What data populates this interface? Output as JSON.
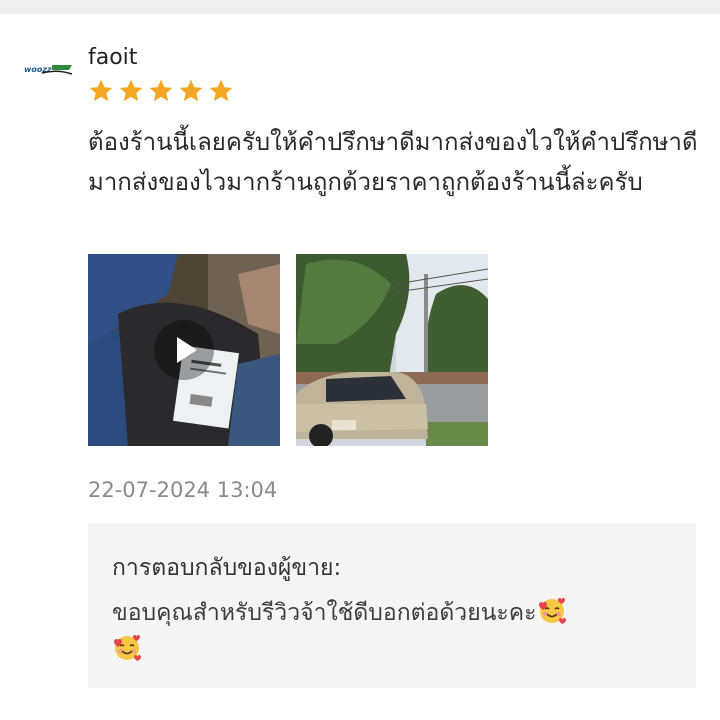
{
  "review": {
    "username": "faoit",
    "rating": 5,
    "text": "ต้องร้านนี้เลยครับให้คำปรึกษาดีมากส่งของไวให้คำปรึกษาดีมากส่งของไวมากร้านถูกด้วยราคาถูกต้องร้านนี้ล่ะครับ",
    "timestamp": "22-07-2024 13:04",
    "media": [
      {
        "type": "video",
        "icon": "play-icon"
      },
      {
        "type": "photo"
      }
    ],
    "star_color": "#f5a623"
  },
  "seller_reply": {
    "title": "การตอบกลับของผู้ขาย:",
    "text": "ขอบคุณสำหรับรีวิวจ้าใช้ดีบอกต่อด้วยนะคะ"
  }
}
